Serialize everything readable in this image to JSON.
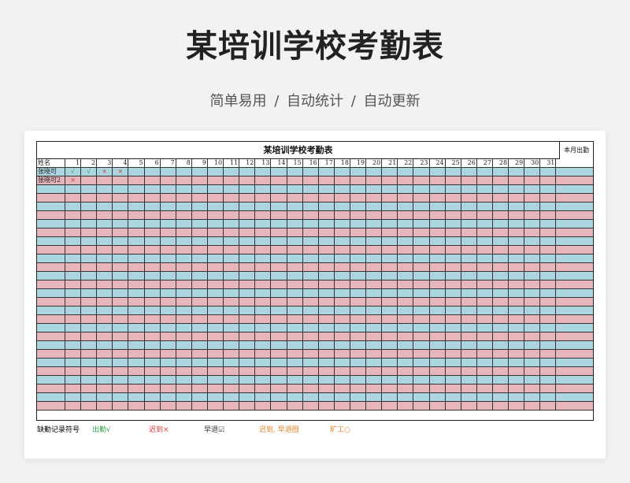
{
  "header": {
    "title": "某培训学校考勤表",
    "subtitle": "简单易用  /  自动统计  /  自动更新"
  },
  "sheet": {
    "title": "某培训学校考勤表",
    "name_header": "姓名",
    "total_header": "本月出勤",
    "days": [
      "1",
      "2",
      "3",
      "4",
      "5",
      "6",
      "7",
      "8",
      "9",
      "10",
      "11",
      "12",
      "13",
      "14",
      "15",
      "16",
      "17",
      "18",
      "19",
      "20",
      "21",
      "22",
      "23",
      "24",
      "25",
      "26",
      "27",
      "28",
      "29",
      "30",
      "31"
    ],
    "row_count": 28,
    "records": [
      {
        "name": "张晓可",
        "marks": [
          "√",
          "√",
          "×",
          "×"
        ]
      },
      {
        "name": "张晓可2",
        "marks": [
          "×"
        ]
      }
    ]
  },
  "legend": {
    "label": "缺勤记录符号",
    "items": [
      {
        "text": "出勤√",
        "color": "#2e9e48"
      },
      {
        "text": "迟到×",
        "color": "#d43a3a"
      },
      {
        "text": "早退☑",
        "color": "#333333"
      },
      {
        "text": "迟到, 早退囫",
        "color": "#e0832a"
      },
      {
        "text": "旷工○",
        "color": "#e0832a"
      }
    ]
  },
  "colors": {
    "row_blue": "#acd6df",
    "row_pink": "#e6b6ba",
    "present": "#2e9e48",
    "late": "#d43a3a",
    "absent": "#e0832a"
  }
}
